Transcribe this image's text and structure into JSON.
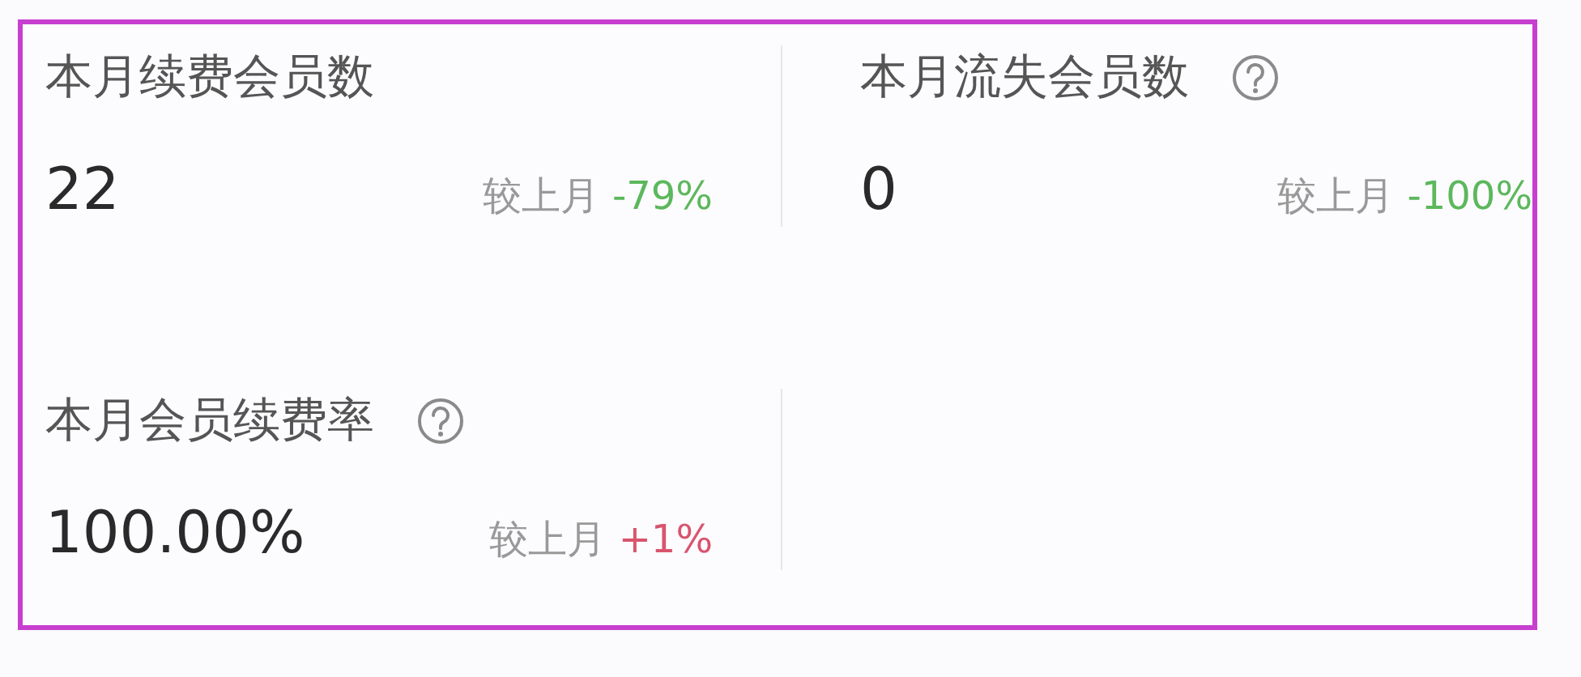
{
  "metrics": [
    {
      "title": "本月续费会员数",
      "help": false,
      "value": "22",
      "compare_label": "较上月",
      "change": "-79%",
      "color": "#5cb85c"
    },
    {
      "title": "本月流失会员数",
      "help": true,
      "value": "0",
      "compare_label": "较上月",
      "change": "-100%",
      "color": "#5cb85c"
    },
    {
      "title": "本月会员续费率",
      "help": true,
      "value": "100.00%",
      "compare_label": "较上月",
      "change": "+1%",
      "color": "#d9546e"
    }
  ]
}
